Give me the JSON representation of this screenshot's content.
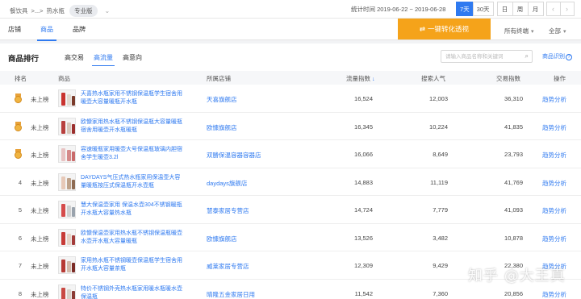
{
  "breadcrumb": {
    "category": "餐饮具",
    "sep": ">...>",
    "current": "热水瓶",
    "edition": "专业版"
  },
  "stat_range": "统计时间 2019-06-22 ~ 2019-06-28",
  "range_buttons": [
    "7天",
    "30天",
    "日",
    "周",
    "月"
  ],
  "active_range": "7天",
  "main_tabs": [
    "店铺",
    "商品",
    "品牌"
  ],
  "active_main_tab": "商品",
  "perspective_button": "一键转化透视",
  "terminal_select": "所有终端",
  "scope_select": "全部",
  "ranking": {
    "title": "商品排行",
    "sub_tabs": [
      "高交易",
      "高流量",
      "高意向"
    ],
    "active_sub_tab": "高流量",
    "search_placeholder": "请输入商品名称和关键词",
    "identify_label": "商品识别"
  },
  "columns": [
    "排名",
    "商品",
    "所属店铺",
    "流量指数",
    "搜索人气",
    "交易指数",
    "操作"
  ],
  "rows": [
    {
      "rank": "1",
      "status": "未上榜",
      "product": "天喜热水瓶家用不锈钢保温瓶学生宿舍用暖壶大容量暖瓶开水瓶",
      "shop": "天喜旗舰店",
      "traffic": "16,524",
      "search": "12,003",
      "trade": "36,310",
      "action": "趋势分析",
      "medal": true
    },
    {
      "rank": "2",
      "status": "未上榜",
      "product": "欧慷家用热水瓶不锈钢保温瓶大容量暖瓶宿舍用暖壶开水瓶暖瓶",
      "shop": "欧慷旗舰店",
      "traffic": "16,345",
      "search": "10,224",
      "trade": "41,835",
      "action": "趋势分析",
      "medal": true
    },
    {
      "rank": "3",
      "status": "未上榜",
      "product": "容速暖瓶家用暖壶大号保温瓶玻璃内胆宿舍学生暖壶3.2l",
      "shop": "双勝保温容器容器店",
      "traffic": "16,066",
      "search": "8,649",
      "trade": "23,793",
      "action": "趋势分析",
      "medal": true
    },
    {
      "rank": "4",
      "status": "未上榜",
      "product": "DAYDAYS气压式热水瓶家用保温壶大容量暖瓶按压式保温瓶开水壶瓶",
      "shop": "daydays旗舰店",
      "traffic": "14,883",
      "search": "11,119",
      "trade": "41,769",
      "action": "趋势分析",
      "medal": false
    },
    {
      "rank": "5",
      "status": "未上榜",
      "product": "慧大保温壶家用 保温水壶304不锈钢暖瓶开水瓶大容量热水瓶",
      "shop": "慧泰家居专营店",
      "traffic": "14,724",
      "search": "7,779",
      "trade": "41,093",
      "action": "趋势分析",
      "medal": false
    },
    {
      "rank": "6",
      "status": "未上榜",
      "product": "欧慷保温壶家用热水瓶不锈钢保温瓶暖壶水壶开水瓶大容量暖瓶",
      "shop": "欧慷旗舰店",
      "traffic": "13,526",
      "search": "3,482",
      "trade": "10,878",
      "action": "趋势分析",
      "medal": false
    },
    {
      "rank": "7",
      "status": "未上榜",
      "product": "家用热水瓶不锈钢暖壶保温瓶学生宿舍用开水瓶大容量茶瓶",
      "shop": "威莱家居专营店",
      "traffic": "12,309",
      "search": "9,429",
      "trade": "22,380",
      "action": "趋势分析",
      "medal": false
    },
    {
      "rank": "8",
      "status": "未上榜",
      "product": "特价不锈钢外壳热水瓶家用暖水瓶暖水壶保温瓶",
      "shop": "晴隆五金家居日用",
      "traffic": "11,542",
      "search": "7,360",
      "trade": "20,856",
      "action": "趋势分析",
      "medal": false
    }
  ],
  "watermark": "知乎 @大王真",
  "colors": {
    "accent": "#2f7af0",
    "perspective": "#f5a31a",
    "medal": "#f0b441"
  }
}
